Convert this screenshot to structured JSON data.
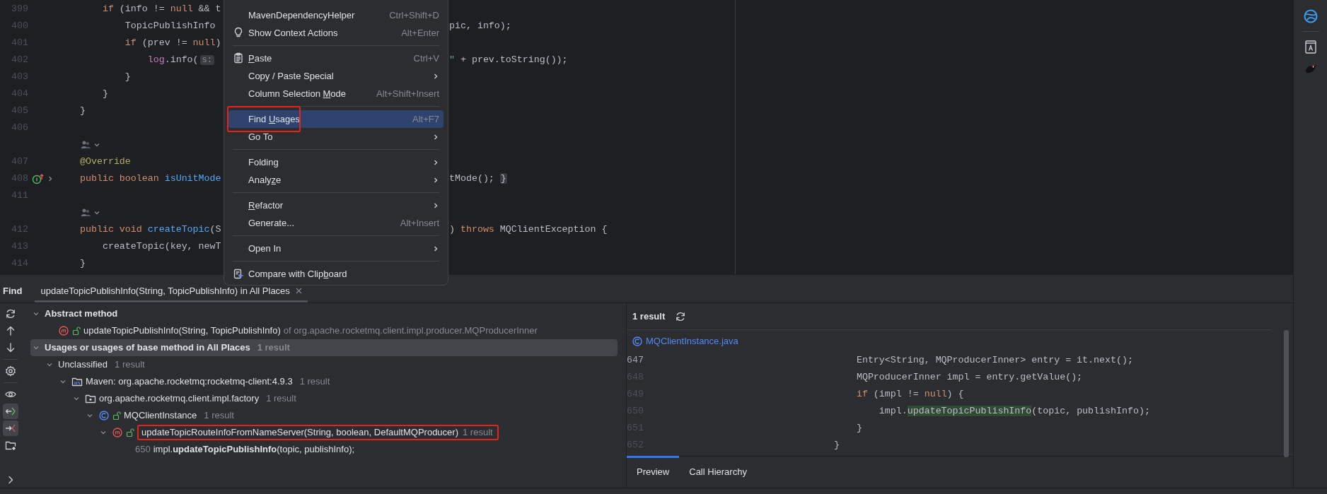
{
  "editor": {
    "lines": [
      {
        "kind": "code",
        "number": "399",
        "left": [
          {
            "text": "    if",
            "kind": "keyword"
          },
          {
            "text": " (info != ",
            "kind": "plain"
          },
          {
            "text": "null",
            "kind": "keyword"
          },
          {
            "text": " && t",
            "kind": "plain"
          }
        ]
      },
      {
        "kind": "code",
        "number": "400",
        "left": [
          {
            "text": "        TopicPublishInfo",
            "kind": "plain"
          }
        ],
        "right": [
          {
            "text": "pic, info);",
            "kind": "plain"
          }
        ]
      },
      {
        "kind": "code",
        "number": "401",
        "left": [
          {
            "text": "        if",
            "kind": "keyword"
          },
          {
            "text": " (prev != ",
            "kind": "plain"
          },
          {
            "text": "null",
            "kind": "keyword"
          },
          {
            "text": ")",
            "kind": "plain"
          }
        ]
      },
      {
        "kind": "code",
        "number": "402",
        "left": [
          {
            "text": "            log",
            "kind": "field"
          },
          {
            "text": ".info(",
            "kind": "plain"
          },
          {
            "text": "s:",
            "kind": "hint"
          }
        ],
        "right": [
          {
            "text": "\"",
            "kind": "string"
          },
          {
            "text": " + prev.toString());",
            "kind": "plain"
          }
        ]
      },
      {
        "kind": "code",
        "number": "403",
        "left": [
          {
            "text": "        }",
            "kind": "plain"
          }
        ]
      },
      {
        "kind": "code",
        "number": "404",
        "left": [
          {
            "text": "    }",
            "kind": "plain"
          }
        ]
      },
      {
        "kind": "code",
        "number": "405",
        "left": [
          {
            "text": "}",
            "kind": "plain"
          }
        ]
      },
      {
        "kind": "code",
        "number": "406"
      },
      {
        "kind": "hint"
      },
      {
        "kind": "code",
        "number": "407",
        "left": [
          {
            "text": "@Override",
            "kind": "annotation"
          }
        ]
      },
      {
        "kind": "implementing",
        "number": "408",
        "left": [
          {
            "text": "public boolean ",
            "kind": "keyword"
          },
          {
            "text": "isUnitMode",
            "kind": "decl"
          }
        ],
        "right": [
          {
            "text": "tMode(); ",
            "kind": "plain"
          },
          {
            "text": "}",
            "kind": "fold"
          }
        ]
      },
      {
        "kind": "code",
        "number": "411"
      },
      {
        "kind": "hint"
      },
      {
        "kind": "code",
        "number": "412",
        "left": [
          {
            "text": "public void ",
            "kind": "keyword"
          },
          {
            "text": "createTopic",
            "kind": "decl"
          },
          {
            "text": "(S",
            "kind": "plain"
          }
        ],
        "right": [
          {
            "text": ") ",
            "kind": "plain"
          },
          {
            "text": "throws",
            "kind": "keyword"
          },
          {
            "text": " MQClientException {",
            "kind": "plain"
          }
        ]
      },
      {
        "kind": "code",
        "number": "413",
        "left": [
          {
            "text": "    createTopic(key, newT",
            "kind": "plain"
          }
        ]
      },
      {
        "kind": "code",
        "number": "414",
        "left": [
          {
            "text": "}",
            "kind": "plain"
          }
        ]
      }
    ]
  },
  "context_menu": {
    "items": [
      {
        "kind": "action",
        "label": "MavenDependencyHelper",
        "shortcut": "Ctrl+Shift+D",
        "submenu": false,
        "selected": false,
        "annotated": false
      },
      {
        "kind": "context",
        "label": "Show Context Actions",
        "shortcut": "Alt+Enter",
        "submenu": false,
        "selected": false,
        "annotated": false
      },
      {
        "kind": "separator"
      },
      {
        "kind": "paste",
        "mnemonic": "P",
        "label_after": "aste",
        "shortcut": "Ctrl+V",
        "submenu": false,
        "selected": false,
        "annotated": false
      },
      {
        "kind": "action",
        "label": "Copy / Paste Special",
        "submenu": true,
        "selected": false,
        "annotated": false
      },
      {
        "kind": "action",
        "label_before": "Column Selection ",
        "mnemonic": "M",
        "label_after": "ode",
        "shortcut": "Alt+Shift+Insert",
        "submenu": false,
        "selected": false,
        "annotated": false
      },
      {
        "kind": "separator"
      },
      {
        "kind": "action",
        "label_before": "Find ",
        "mnemonic": "U",
        "label_after": "sages",
        "shortcut": "Alt+F7",
        "submenu": false,
        "selected": true,
        "annotated": true
      },
      {
        "kind": "action",
        "label": "Go To",
        "submenu": true,
        "selected": false,
        "annotated": false
      },
      {
        "kind": "separator"
      },
      {
        "kind": "action",
        "label": "Folding",
        "submenu": true,
        "selected": false,
        "annotated": false
      },
      {
        "kind": "action",
        "label_before": "Analy",
        "mnemonic": "z",
        "label_after": "e",
        "submenu": true,
        "selected": false,
        "annotated": false
      },
      {
        "kind": "separator"
      },
      {
        "kind": "action",
        "mnemonic": "R",
        "label_after": "efactor",
        "submenu": true,
        "selected": false,
        "annotated": false
      },
      {
        "kind": "action",
        "label": "Generate...",
        "shortcut": "Alt+Insert",
        "submenu": false,
        "selected": false,
        "annotated": false
      },
      {
        "kind": "separator"
      },
      {
        "kind": "action",
        "label": "Open In",
        "submenu": true,
        "selected": false,
        "annotated": false
      },
      {
        "kind": "separator"
      },
      {
        "kind": "compare",
        "label_before": "Compare with Clip",
        "mnemonic": "b",
        "label_after": "oard",
        "submenu": false,
        "selected": false,
        "annotated": false
      }
    ]
  },
  "find": {
    "title": "Find",
    "tabs": [
      {
        "label": "updateTopicPublishInfo(String, TopicPublishInfo) in All Places",
        "selected": true
      }
    ],
    "toolbar": [
      {
        "kind": "refresh",
        "selected": false
      },
      {
        "kind": "up",
        "selected": false
      },
      {
        "kind": "down",
        "selected": false
      },
      {
        "kind": "separator"
      },
      {
        "kind": "settings",
        "selected": false
      },
      {
        "kind": "separator"
      },
      {
        "kind": "eye",
        "selected": false
      },
      {
        "kind": "import",
        "selected": true
      },
      {
        "kind": "export",
        "selected": true
      },
      {
        "kind": "folder",
        "selected": false
      },
      {
        "kind": "expand",
        "selected": false
      }
    ],
    "tree": [
      {
        "kind": "group",
        "label": "Abstract method",
        "expanded": true,
        "selected": false,
        "annotated": false,
        "children": [
          {
            "kind": "method",
            "label": "updateTopicPublishInfo(String, TopicPublishInfo)",
            "suffix": " of org.apache.rocketmq.client.impl.producer.MQProducerInner",
            "selected": false,
            "annotated": false
          }
        ]
      },
      {
        "kind": "group",
        "label": "Usages or usages of base method in All Places",
        "count": "1 result",
        "expanded": true,
        "selected": true,
        "annotated": false,
        "children": [
          {
            "kind": "category",
            "label": "Unclassified",
            "count": "1 result",
            "expanded": true,
            "selected": false,
            "annotated": false,
            "children": [
              {
                "kind": "library",
                "label": "Maven: org.apache.rocketmq:rocketmq-client:4.9.3",
                "count": "1 result",
                "expanded": true,
                "selected": false,
                "annotated": false,
                "children": [
                  {
                    "kind": "package",
                    "label": "org.apache.rocketmq.client.impl.factory",
                    "count": "1 result",
                    "expanded": true,
                    "selected": false,
                    "annotated": false,
                    "children": [
                      {
                        "kind": "class",
                        "label": "MQClientInstance",
                        "count": "1 result",
                        "expanded": true,
                        "selected": false,
                        "annotated": false,
                        "children": [
                          {
                            "kind": "method",
                            "label": "updateTopicRouteInfoFromNameServer(String, boolean, DefaultMQProducer)",
                            "count": "1 result",
                            "expanded": true,
                            "selected": false,
                            "annotated": true,
                            "children": [
                              {
                                "kind": "usage",
                                "line": "650",
                                "label": "impl.**updateTopicPublishInfo**(topic, publishInfo);",
                                "selected": false,
                                "annotated": false
                              }
                            ]
                          }
                        ]
                      }
                    ]
                  }
                ]
              }
            ]
          }
        ]
      }
    ],
    "preview": {
      "summary": "1 result",
      "file": "MQClientInstance.java",
      "lines": [
        {
          "number": "647",
          "current": true,
          "tokens": [
            {
              "text": "    Entry<String, MQProducerInner> entry = it.next();",
              "kind": "plain"
            }
          ]
        },
        {
          "number": "648",
          "current": false,
          "tokens": [
            {
              "text": "    MQProducerInner impl = entry.getValue();",
              "kind": "plain"
            }
          ]
        },
        {
          "number": "649",
          "current": false,
          "tokens": [
            {
              "text": "    if",
              "kind": "keyword"
            },
            {
              "text": " (impl != ",
              "kind": "plain"
            },
            {
              "text": "null",
              "kind": "keyword"
            },
            {
              "text": ") {",
              "kind": "plain"
            }
          ]
        },
        {
          "number": "650",
          "current": false,
          "tokens": [
            {
              "text": "        impl.",
              "kind": "plain"
            },
            {
              "text": "updateTopicPublishInfo",
              "kind": "usage"
            },
            {
              "text": "(topic, publishInfo);",
              "kind": "plain"
            }
          ]
        },
        {
          "number": "651",
          "current": false,
          "tokens": [
            {
              "text": "    }",
              "kind": "plain"
            }
          ]
        },
        {
          "number": "652",
          "current": false,
          "tokens": [
            {
              "text": "}",
              "kind": "plain"
            }
          ]
        }
      ],
      "tabs": [
        {
          "label": "Preview",
          "selected": true
        },
        {
          "label": "Call Hierarchy",
          "selected": false
        }
      ]
    }
  },
  "side_toolbar": [
    {
      "kind": "globe"
    },
    {
      "kind": "separator"
    },
    {
      "kind": "book"
    },
    {
      "kind": "bird"
    }
  ]
}
